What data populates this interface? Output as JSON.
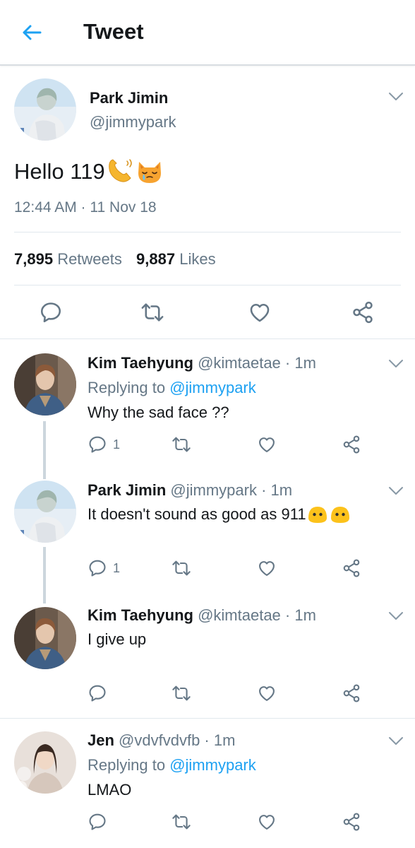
{
  "header": {
    "title": "Tweet",
    "back_icon": "arrow-left-icon",
    "accent": "#1da1f2"
  },
  "main_tweet": {
    "name": "Park Jimin",
    "handle": "@jimmypark",
    "text": "Hello 119",
    "emojis": [
      "telephone-receiver-emoji",
      "crying-cat-face-emoji"
    ],
    "timestamp": "12:44 AM · 11 Nov 18",
    "retweets_count": "7,895",
    "retweets_label": "Retweets",
    "likes_count": "9,887",
    "likes_label": "Likes"
  },
  "replies": [
    {
      "name": "Kim Taehyung",
      "handle": "@kimtaetae · 1m",
      "replying_prefix": "Replying to",
      "replying_to": "@jimmypark",
      "text": "Why the sad face ??",
      "reply_count": "1"
    },
    {
      "name": "Park Jimin",
      "handle": "@jimmypark · 1m",
      "text": "It doesn't sound as good as 911",
      "emojis": [
        "face-without-mouth-emoji",
        "face-without-mouth-emoji"
      ],
      "reply_count": "1"
    },
    {
      "name": "Kim Taehyung",
      "handle": "@kimtaetae · 1m",
      "text": "I give up",
      "reply_count": ""
    },
    {
      "name": "Jen",
      "handle": "@vdvfvdvfb · 1m",
      "replying_prefix": "Replying to",
      "replying_to": "@jimmypark",
      "text": "LMAO",
      "reply_count": ""
    }
  ]
}
